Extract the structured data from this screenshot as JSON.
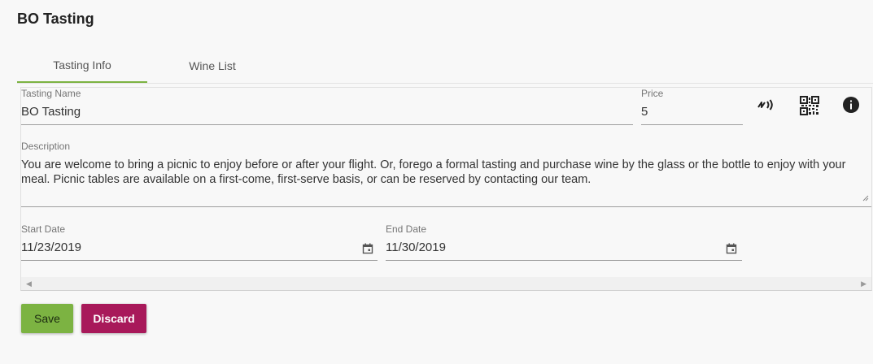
{
  "page": {
    "title": "BO Tasting"
  },
  "tabs": [
    {
      "label": "Tasting Info",
      "active": true
    },
    {
      "label": "Wine List",
      "active": false
    }
  ],
  "form": {
    "tasting_name": {
      "label": "Tasting Name",
      "value": "BO Tasting"
    },
    "price": {
      "label": "Price",
      "value": "5"
    },
    "description": {
      "label": "Description",
      "value": "You are welcome to bring a picnic to enjoy before or after your flight. Or, forego a formal tasting and purchase wine by the glass or the bottle to enjoy with your meal. Picnic tables are available on a first-come, first-serve basis, or can be reserved by contacting our team."
    },
    "start_date": {
      "label": "Start Date",
      "value": "11/23/2019"
    },
    "end_date": {
      "label": "End Date",
      "value": "11/30/2019"
    }
  },
  "toolbar_icons": [
    "nfc-icon",
    "qr-code-icon",
    "info-icon"
  ],
  "actions": {
    "save_label": "Save",
    "discard_label": "Discard"
  },
  "colors": {
    "accent_green": "#7cb342",
    "discard_magenta": "#a8195a"
  }
}
